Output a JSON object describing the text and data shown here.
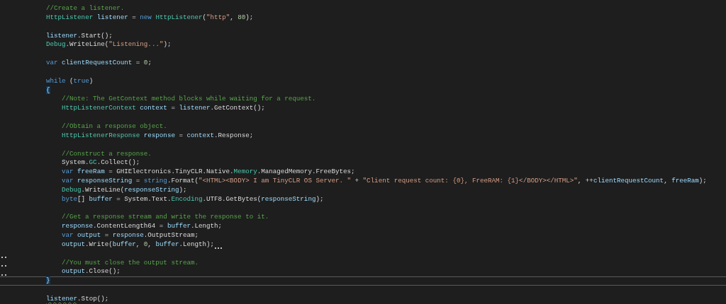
{
  "lines": [
    {
      "kind": "code",
      "current": false,
      "gutter_mark": false,
      "tokens": [
        {
          "kind": "comment",
          "text": "//Create a listener."
        }
      ]
    },
    {
      "kind": "code",
      "current": false,
      "gutter_mark": false,
      "tokens": [
        {
          "kind": "type",
          "text": "HttpListener"
        },
        {
          "kind": "variable",
          "text": " listener"
        },
        {
          "kind": "plain",
          "text": " = "
        },
        {
          "kind": "keyword",
          "text": "new"
        },
        {
          "kind": "type",
          "text": " HttpListener"
        },
        {
          "kind": "plain",
          "text": "("
        },
        {
          "kind": "string",
          "text": "\"http\""
        },
        {
          "kind": "plain",
          "text": ", "
        },
        {
          "kind": "number",
          "text": "80"
        },
        {
          "kind": "plain",
          "text": ");"
        }
      ]
    },
    {
      "kind": "blank",
      "current": false,
      "gutter_mark": false
    },
    {
      "kind": "code",
      "current": false,
      "gutter_mark": false,
      "tokens": [
        {
          "kind": "variable",
          "text": "listener"
        },
        {
          "kind": "plain",
          "text": ".Start();"
        }
      ]
    },
    {
      "kind": "code",
      "current": false,
      "gutter_mark": false,
      "tokens": [
        {
          "kind": "type",
          "text": "Debug"
        },
        {
          "kind": "plain",
          "text": ".WriteLine("
        },
        {
          "kind": "string",
          "text": "\"Listening...\""
        },
        {
          "kind": "plain",
          "text": ");"
        }
      ]
    },
    {
      "kind": "blank",
      "current": false,
      "gutter_mark": false
    },
    {
      "kind": "code",
      "current": false,
      "gutter_mark": false,
      "tokens": [
        {
          "kind": "keyword",
          "text": "var"
        },
        {
          "kind": "variable",
          "text": " clientRequestCount"
        },
        {
          "kind": "plain",
          "text": " = "
        },
        {
          "kind": "number",
          "text": "0"
        },
        {
          "kind": "plain",
          "text": ";"
        }
      ]
    },
    {
      "kind": "blank",
      "current": false,
      "gutter_mark": false
    },
    {
      "kind": "code",
      "current": false,
      "gutter_mark": false,
      "tokens": [
        {
          "kind": "keyword",
          "text": "while"
        },
        {
          "kind": "plain",
          "text": " ("
        },
        {
          "kind": "keyword",
          "text": "true"
        },
        {
          "kind": "plain",
          "text": ")"
        }
      ]
    },
    {
      "kind": "code",
      "current": false,
      "gutter_mark": false,
      "tokens": [
        {
          "kind": "brace-match",
          "text": "{"
        }
      ],
      "children": [
        {
          "kind": "code",
          "current": false,
          "gutter_mark": false,
          "tokens": [
            {
              "kind": "comment",
              "text": "//Note: The GetContext method blocks while waiting for a request."
            }
          ]
        },
        {
          "kind": "code",
          "current": false,
          "gutter_mark": false,
          "tokens": [
            {
              "kind": "type",
              "text": "HttpListenerContext"
            },
            {
              "kind": "variable",
              "text": " context"
            },
            {
              "kind": "plain",
              "text": " = "
            },
            {
              "kind": "variable",
              "text": "listener"
            },
            {
              "kind": "plain",
              "text": ".GetContext();"
            }
          ]
        },
        {
          "kind": "blank",
          "current": false,
          "gutter_mark": false
        },
        {
          "kind": "code",
          "current": false,
          "gutter_mark": false,
          "tokens": [
            {
              "kind": "comment",
              "text": "//Obtain a response object."
            }
          ]
        },
        {
          "kind": "code",
          "current": false,
          "gutter_mark": false,
          "tokens": [
            {
              "kind": "type",
              "text": "HttpListenerResponse"
            },
            {
              "kind": "variable",
              "text": " response"
            },
            {
              "kind": "plain",
              "text": " = "
            },
            {
              "kind": "variable",
              "text": "context"
            },
            {
              "kind": "plain",
              "text": ".Response;"
            }
          ]
        },
        {
          "kind": "blank",
          "current": false,
          "gutter_mark": false
        },
        {
          "kind": "code",
          "current": false,
          "gutter_mark": false,
          "tokens": [
            {
              "kind": "comment",
              "text": "//Construct a response."
            }
          ]
        },
        {
          "kind": "code",
          "current": false,
          "gutter_mark": false,
          "tokens": [
            {
              "kind": "plain",
              "text": "System."
            },
            {
              "kind": "type",
              "text": "GC"
            },
            {
              "kind": "plain",
              "text": ".Collect();"
            }
          ]
        },
        {
          "kind": "code",
          "current": false,
          "gutter_mark": false,
          "tokens": [
            {
              "kind": "keyword",
              "text": "var"
            },
            {
              "kind": "variable",
              "text": " freeRam"
            },
            {
              "kind": "plain",
              "text": " = GHIElectronics.TinyCLR.Native."
            },
            {
              "kind": "type",
              "text": "Memory"
            },
            {
              "kind": "plain",
              "text": ".ManagedMemory.FreeBytes;"
            }
          ]
        },
        {
          "kind": "code",
          "current": false,
          "gutter_mark": false,
          "tokens": [
            {
              "kind": "keyword",
              "text": "var"
            },
            {
              "kind": "variable",
              "text": " responseString"
            },
            {
              "kind": "plain",
              "text": " = "
            },
            {
              "kind": "keyword",
              "text": "string"
            },
            {
              "kind": "plain",
              "text": ".Format("
            },
            {
              "kind": "string",
              "text": "\"<HTML><BODY> I am TinyCLR OS Server. \""
            },
            {
              "kind": "plain",
              "text": " + "
            },
            {
              "kind": "string",
              "text": "\"Client request count: {0}, FreeRAM: {1}</BODY></HTML>\""
            },
            {
              "kind": "plain",
              "text": ", ++"
            },
            {
              "kind": "variable",
              "text": "clientRequestCount"
            },
            {
              "kind": "plain",
              "text": ", "
            },
            {
              "kind": "variable",
              "text": "freeRam"
            },
            {
              "kind": "plain",
              "text": ");"
            }
          ]
        },
        {
          "kind": "code",
          "current": false,
          "gutter_mark": false,
          "tokens": [
            {
              "kind": "type",
              "text": "Debug"
            },
            {
              "kind": "plain",
              "text": ".WriteLine("
            },
            {
              "kind": "variable",
              "text": "responseString"
            },
            {
              "kind": "plain",
              "text": ");"
            }
          ]
        },
        {
          "kind": "code",
          "current": false,
          "gutter_mark": false,
          "tokens": [
            {
              "kind": "keyword",
              "text": "byte"
            },
            {
              "kind": "plain",
              "text": "[] "
            },
            {
              "kind": "variable",
              "text": "buffer"
            },
            {
              "kind": "plain",
              "text": " = System.Text."
            },
            {
              "kind": "type",
              "text": "Encoding"
            },
            {
              "kind": "plain",
              "text": ".UTF8.GetBytes("
            },
            {
              "kind": "variable",
              "text": "responseString"
            },
            {
              "kind": "plain",
              "text": ");"
            }
          ]
        },
        {
          "kind": "blank",
          "current": false,
          "gutter_mark": false
        },
        {
          "kind": "code",
          "current": false,
          "gutter_mark": false,
          "tokens": [
            {
              "kind": "comment",
              "text": "//Get a response stream and write the response to it."
            }
          ]
        },
        {
          "kind": "code",
          "current": false,
          "gutter_mark": false,
          "tokens": [
            {
              "kind": "variable",
              "text": "response"
            },
            {
              "kind": "plain",
              "text": ".ContentLength64 = "
            },
            {
              "kind": "variable",
              "text": "buffer"
            },
            {
              "kind": "plain",
              "text": ".Length;"
            }
          ]
        },
        {
          "kind": "code",
          "current": false,
          "gutter_mark": false,
          "tokens": [
            {
              "kind": "keyword",
              "text": "var"
            },
            {
              "kind": "variable",
              "text": " output"
            },
            {
              "kind": "plain",
              "text": " = "
            },
            {
              "kind": "variable",
              "text": "response"
            },
            {
              "kind": "plain",
              "text": ".OutputStream;"
            }
          ]
        },
        {
          "kind": "code",
          "current": false,
          "gutter_mark": false,
          "hint": true,
          "tokens": [
            {
              "kind": "variable",
              "text": "output"
            },
            {
              "kind": "plain",
              "text": ".Write("
            },
            {
              "kind": "variable",
              "text": "buffer"
            },
            {
              "kind": "plain",
              "text": ", "
            },
            {
              "kind": "number",
              "text": "0"
            },
            {
              "kind": "plain",
              "text": ", "
            },
            {
              "kind": "variable",
              "text": "buffer"
            },
            {
              "kind": "plain",
              "text": ".Length);"
            }
          ]
        },
        {
          "kind": "blank",
          "current": false,
          "gutter_mark": true
        },
        {
          "kind": "code",
          "current": false,
          "gutter_mark": true,
          "tokens": [
            {
              "kind": "comment",
              "text": "//You must close the output stream."
            }
          ]
        },
        {
          "kind": "code",
          "current": false,
          "gutter_mark": true,
          "tokens": [
            {
              "kind": "variable",
              "text": "output"
            },
            {
              "kind": "plain",
              "text": ".Close();"
            }
          ]
        }
      ]
    },
    {
      "kind": "code",
      "current": true,
      "gutter_mark": false,
      "tokens": [
        {
          "kind": "brace-match",
          "text": "}"
        }
      ]
    },
    {
      "kind": "blank",
      "current": false,
      "gutter_mark": false
    },
    {
      "kind": "code",
      "current": false,
      "gutter_mark": false,
      "tokens": [
        {
          "kind": "warning",
          "text": "listener"
        },
        {
          "kind": "plain",
          "text": ".Stop();"
        }
      ]
    }
  ]
}
